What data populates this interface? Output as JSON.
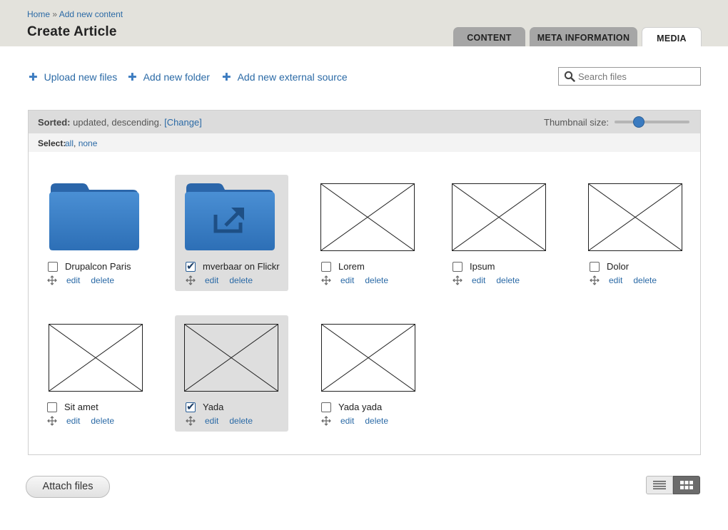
{
  "breadcrumb": {
    "home": "Home",
    "separator": "»",
    "current": "Add new content"
  },
  "page_title": "Create Article",
  "tabs": [
    {
      "label": "CONTENT",
      "active": false
    },
    {
      "label": "META INFORMATION",
      "active": false
    },
    {
      "label": "MEDIA",
      "active": true
    }
  ],
  "toolbar": {
    "upload": "Upload new files",
    "add_folder": "Add new folder",
    "add_external": "Add new external source"
  },
  "search": {
    "placeholder": "Search files",
    "value": ""
  },
  "sortbar": {
    "label": "Sorted:",
    "value": "updated, descending.",
    "change": "[Change]",
    "thumb_size_label": "Thumbnail size:",
    "thumb_size_level": 0.27
  },
  "selectbar": {
    "label": "Select:",
    "all": "all",
    "separator": ",",
    "none": "none"
  },
  "items": [
    {
      "name": "Drupalcon Paris",
      "type": "folder",
      "checked": false
    },
    {
      "name": "mverbaar on Flickr",
      "type": "external-folder",
      "checked": true
    },
    {
      "name": "Lorem",
      "type": "image",
      "checked": false
    },
    {
      "name": "Ipsum",
      "type": "image",
      "checked": false
    },
    {
      "name": "Dolor",
      "type": "image",
      "checked": false
    },
    {
      "name": "Sit amet",
      "type": "image",
      "checked": false
    },
    {
      "name": "Yada",
      "type": "image",
      "checked": true
    },
    {
      "name": "Yada yada",
      "type": "image",
      "checked": false
    }
  ],
  "item_actions": {
    "edit": "edit",
    "delete": "delete"
  },
  "attach_button": "Attach files",
  "view_mode": "grid",
  "colors": {
    "accent": "#2b6aa6",
    "folder": "#3b7bc0",
    "header_bg": "#e3e2dc"
  }
}
